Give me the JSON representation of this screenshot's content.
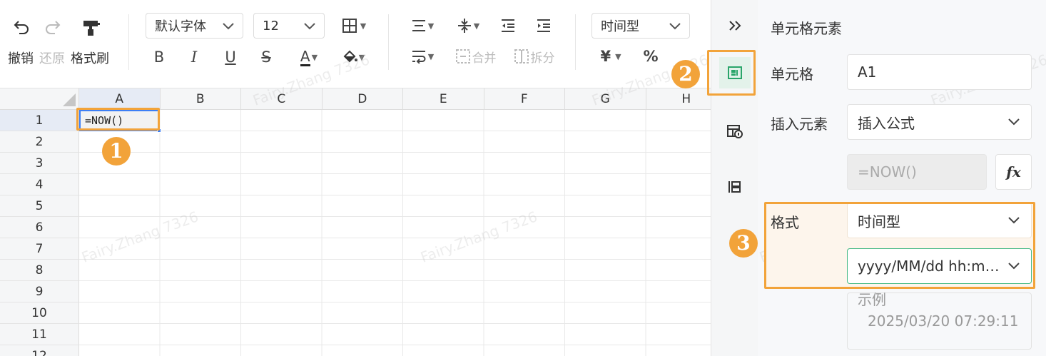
{
  "toolbar": {
    "undo_label": "撤销",
    "redo_label": "还原",
    "format_painter_label": "格式刷",
    "font_family": "默认字体",
    "font_size": "12",
    "bold": "B",
    "italic": "I",
    "underline": "U",
    "strike": "S",
    "font_color": "A",
    "merge_label": "合并",
    "split_label": "拆分",
    "number_format": "时间型",
    "currency": "¥",
    "percent": "%"
  },
  "grid": {
    "columns": [
      "A",
      "B",
      "C",
      "D",
      "E",
      "F",
      "G",
      "H"
    ],
    "rows": [
      "1",
      "2",
      "3",
      "4",
      "5",
      "6",
      "7",
      "8",
      "9",
      "10",
      "11",
      "12"
    ],
    "active_cell_value": "=NOW()"
  },
  "panel": {
    "title": "单元格元素",
    "cell_label": "单元格",
    "cell_value": "A1",
    "insert_label": "插入元素",
    "insert_value": "插入公式",
    "formula_value": "=NOW()",
    "fx_label": "fx",
    "format_label": "格式",
    "format_type": "时间型",
    "format_pattern": "yyyy/MM/dd hh:m…",
    "sample_label": "示例",
    "sample_value": "2025/03/20 07:29:11"
  },
  "annotations": {
    "badge_1": "1",
    "badge_2": "2",
    "badge_3": "3"
  },
  "watermark": "Fairy.Zhang 7326",
  "colors": {
    "highlight": "#f2a33a",
    "selection": "#3d7ff5",
    "accent_green": "#41b883"
  }
}
